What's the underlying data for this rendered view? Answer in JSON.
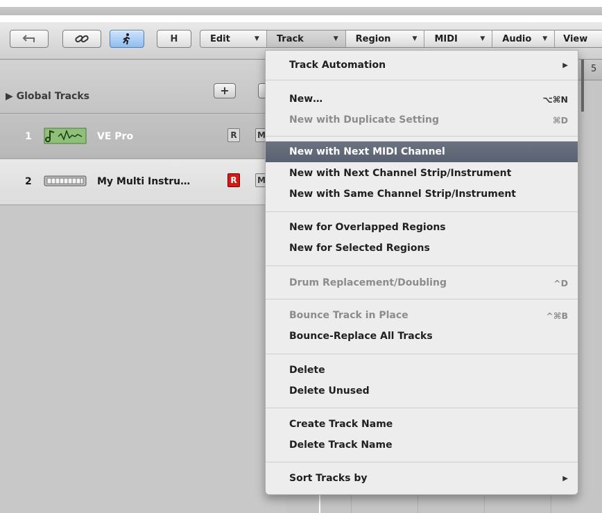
{
  "toolbar": {
    "h_label": "H",
    "menus": [
      {
        "label": "Edit",
        "width": 96
      },
      {
        "label": "Track",
        "width": 114
      },
      {
        "label": "Region",
        "width": 114
      },
      {
        "label": "MIDI",
        "width": 98
      },
      {
        "label": "Audio",
        "width": 90
      },
      {
        "label": "View",
        "width": 88
      }
    ],
    "menu_arrow": "▼"
  },
  "global_tracks": {
    "label": "▶ Global Tracks",
    "add_label": "+"
  },
  "tracks": [
    {
      "number": "1",
      "name": "VE Pro",
      "record": "R",
      "mute": "M"
    },
    {
      "number": "2",
      "name": "My Multi Instru…",
      "record": "R",
      "mute": "M"
    }
  ],
  "ruler": {
    "marker": "5"
  },
  "track_menu": {
    "items": [
      {
        "label": "Track Automation",
        "shortcut": "",
        "submenu": "▶"
      },
      {
        "label": "New…",
        "shortcut": "⌥⌘N"
      },
      {
        "label": "New with Duplicate Setting",
        "shortcut": "⌘D",
        "disabled": true
      },
      {
        "label": "New with Next MIDI Channel",
        "shortcut": "",
        "highlight": true
      },
      {
        "label": "New with Next Channel Strip/Instrument",
        "shortcut": ""
      },
      {
        "label": "New with Same Channel Strip/Instrument",
        "shortcut": ""
      },
      {
        "label": "New for Overlapped Regions",
        "shortcut": ""
      },
      {
        "label": "New for Selected Regions",
        "shortcut": ""
      },
      {
        "label": "Drum Replacement/Doubling",
        "shortcut": "^D",
        "disabled": true
      },
      {
        "label": "Bounce Track in Place",
        "shortcut": "^⌘B",
        "disabled": true
      },
      {
        "label": "Bounce-Replace All Tracks",
        "shortcut": ""
      },
      {
        "label": "Delete",
        "shortcut": ""
      },
      {
        "label": "Delete Unused",
        "shortcut": ""
      },
      {
        "label": "Create Track Name",
        "shortcut": ""
      },
      {
        "label": "Delete Track Name",
        "shortcut": ""
      },
      {
        "label": "Sort Tracks by",
        "shortcut": "",
        "submenu": "▶"
      }
    ]
  },
  "colors": {
    "highlight": "#5f6675",
    "record_armed": "#d01b16"
  }
}
